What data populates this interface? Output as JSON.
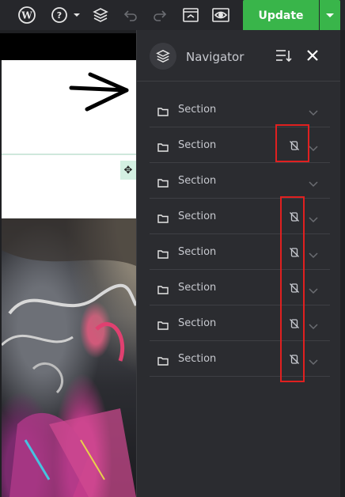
{
  "toolbar": {
    "icons": [
      "wordpress-icon",
      "help-icon",
      "layers-icon",
      "undo-icon",
      "redo-icon",
      "template-icon",
      "preview-icon"
    ],
    "update_label": "Update",
    "update_color": "#39b54a"
  },
  "navigator": {
    "title": "Navigator",
    "items": [
      {
        "label": "Section",
        "hidden": false
      },
      {
        "label": "Section",
        "hidden": true
      },
      {
        "label": "Section",
        "hidden": false
      },
      {
        "label": "Section",
        "hidden": true
      },
      {
        "label": "Section",
        "hidden": true
      },
      {
        "label": "Section",
        "hidden": true
      },
      {
        "label": "Section",
        "hidden": true
      },
      {
        "label": "Section",
        "hidden": true
      }
    ]
  },
  "colors": {
    "panel_bg": "#2b2c30",
    "annotation": "#e02020"
  }
}
